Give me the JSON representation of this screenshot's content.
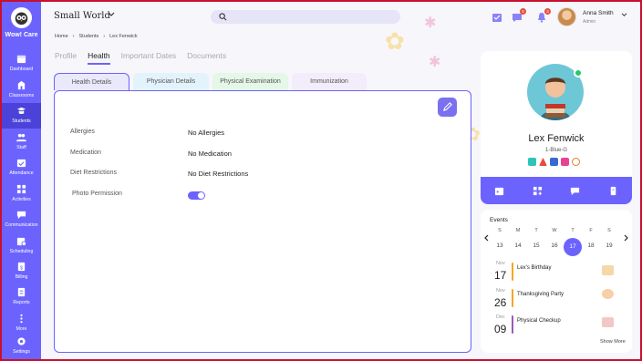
{
  "app": {
    "name": "Wow! Care"
  },
  "sidebar": {
    "items": [
      {
        "label": "Dashboard",
        "icon": "calendar-icon"
      },
      {
        "label": "Classrooms",
        "icon": "classroom-icon"
      },
      {
        "label": "Students",
        "icon": "student-icon",
        "active": true
      },
      {
        "label": "Staff",
        "icon": "staff-icon"
      },
      {
        "label": "Attendance",
        "icon": "attendance-icon"
      },
      {
        "label": "Activities",
        "icon": "activities-icon"
      },
      {
        "label": "Communication",
        "icon": "chat-icon"
      },
      {
        "label": "Scheduling",
        "icon": "scheduling-icon"
      },
      {
        "label": "Billing",
        "icon": "billing-icon"
      },
      {
        "label": "Reports",
        "icon": "reports-icon"
      },
      {
        "label": "More",
        "icon": "more-icon"
      },
      {
        "label": "Settings",
        "icon": "gear-icon"
      }
    ]
  },
  "topbar": {
    "school": "Small World",
    "messages_badge": "5",
    "notifications_badge": "3",
    "user_name": "Anna Smith",
    "user_role": "Admin"
  },
  "breadcrumb": [
    "Home",
    "Students",
    "Lex Fenwick"
  ],
  "page_tabs": [
    "Profile",
    "Health",
    "Important Dates",
    "Documents"
  ],
  "active_page_tab": "Health",
  "sub_tabs": [
    "Health Details",
    "Physician Details",
    "Physical Examination",
    "Immunization"
  ],
  "active_sub_tab": "Health Details",
  "health": {
    "allergies_label": "Allergies",
    "allergies_value": "No Allergies",
    "medication_label": "Medication",
    "medication_value": "No Medication",
    "diet_label": "Diet Restrictions",
    "diet_value": "No Diet Restrictions",
    "photo_label": "Photo Permission",
    "photo_permission": true
  },
  "profile": {
    "name": "Lex Fenwick",
    "class": "1-Blue-G",
    "online": true
  },
  "events": {
    "title": "Events",
    "days_of_week": [
      "S",
      "M",
      "T",
      "W",
      "T",
      "F",
      "S"
    ],
    "dates": [
      "13",
      "14",
      "15",
      "16",
      "17",
      "18",
      "19"
    ],
    "selected_date": "17",
    "items": [
      {
        "month": "Nov",
        "day": "17",
        "name": "Lex's Birthday",
        "color": "#f5a623"
      },
      {
        "month": "Nov",
        "day": "26",
        "name": "Thanksgiving Party",
        "color": "#f5a623"
      },
      {
        "month": "Dec",
        "day": "09",
        "name": "Physical Checkup",
        "color": "#9b59b6"
      }
    ],
    "show_more": "Show More"
  },
  "colors": {
    "accent": "#6c63ff",
    "accent_dark": "#4b43d9",
    "online": "#28c76f"
  }
}
